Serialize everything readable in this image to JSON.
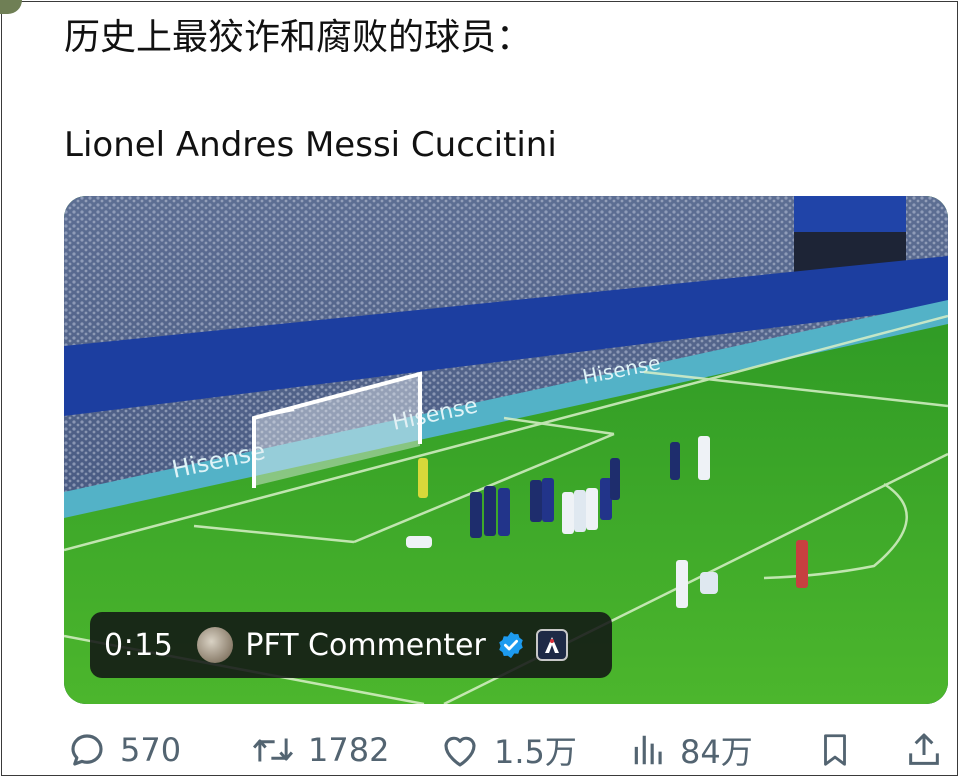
{
  "post": {
    "text_line1": "历史上最狡诈和腐败的球员：",
    "text_line2": "Lionel Andres Messi Cuccitini"
  },
  "video": {
    "duration": "0:15",
    "author": "PFT Commenter",
    "verified_color": "#1d9bf0",
    "ad_board_text": "Hisense"
  },
  "actions": {
    "replies": "570",
    "reposts": "1782",
    "likes": "1.5万",
    "views": "84万"
  },
  "icons": [
    "reply-icon",
    "repost-icon",
    "like-icon",
    "views-icon",
    "bookmark-icon",
    "share-icon",
    "verified-badge-icon"
  ]
}
